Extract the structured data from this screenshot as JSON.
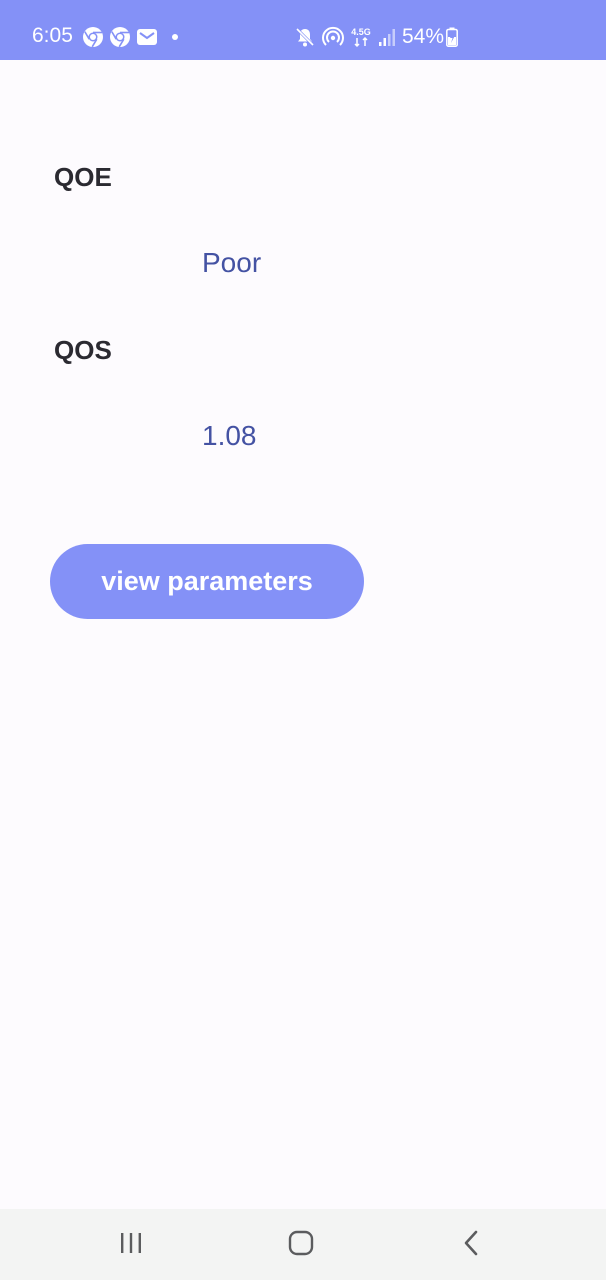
{
  "status_bar": {
    "time": "6:05",
    "battery_percent": "54%",
    "network_label": "4.5G",
    "left_icons": [
      "chrome-icon",
      "chrome-icon",
      "mail-icon",
      "notification-dot-icon"
    ],
    "right_icons": [
      "mute-icon",
      "hotspot-icon",
      "network-4-5g-icon",
      "signal-icon",
      "battery-charging-icon"
    ]
  },
  "metrics": {
    "qoe": {
      "label": "QOE",
      "value": "Poor"
    },
    "qos": {
      "label": "QOS",
      "value": "1.08"
    }
  },
  "actions": {
    "view_parameters_label": "view parameters"
  },
  "nav_bar": {
    "icons": [
      "recents-icon",
      "home-icon",
      "back-icon"
    ]
  },
  "colors": {
    "accent": "#8491f7",
    "value_text": "#4452a3",
    "label_text": "#2b2a31",
    "background": "#fdfbfe",
    "nav_background": "#f3f4f3"
  }
}
